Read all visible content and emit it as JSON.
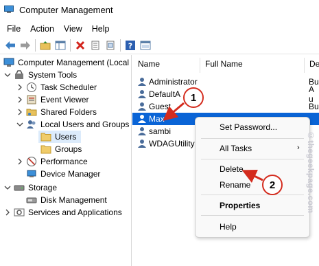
{
  "window": {
    "title": "Computer Management"
  },
  "menubar": {
    "items": [
      "File",
      "Action",
      "View",
      "Help"
    ]
  },
  "toolbar": {
    "buttons": [
      "back-icon",
      "forward-icon",
      "up-folder-icon",
      "show-hide-tree-icon",
      "delete-icon",
      "properties-icon",
      "export-list-icon",
      "help-icon",
      "mmc-pane-icon"
    ]
  },
  "tree": {
    "items": [
      {
        "label": "Computer Management (Local",
        "icon": "computer-icon"
      },
      {
        "label": "System Tools",
        "icon": "tools-icon"
      },
      {
        "label": "Task Scheduler",
        "icon": "clock-icon"
      },
      {
        "label": "Event Viewer",
        "icon": "event-viewer-icon"
      },
      {
        "label": "Shared Folders",
        "icon": "shared-folder-icon"
      },
      {
        "label": "Local Users and Groups",
        "icon": "users-icon"
      },
      {
        "label": "Users",
        "icon": "folder-icon"
      },
      {
        "label": "Groups",
        "icon": "folder-icon"
      },
      {
        "label": "Performance",
        "icon": "performance-icon"
      },
      {
        "label": "Device Manager",
        "icon": "device-manager-icon"
      },
      {
        "label": "Storage",
        "icon": "storage-icon"
      },
      {
        "label": "Disk Management",
        "icon": "disk-icon"
      },
      {
        "label": "Services and Applications",
        "icon": "services-icon"
      }
    ]
  },
  "list": {
    "columns": [
      "Name",
      "Full Name",
      "De"
    ],
    "rows": [
      {
        "name": "Administrator",
        "full_name": "",
        "desc": "Bu"
      },
      {
        "name": "DefaultA",
        "full_name": "",
        "desc": "A u"
      },
      {
        "name": "Guest",
        "full_name": "",
        "desc": "Bu"
      },
      {
        "name": "Max",
        "full_name": "",
        "desc": ""
      },
      {
        "name": "sambi",
        "full_name": "",
        "desc": ""
      },
      {
        "name": "WDAGUtility",
        "full_name": "",
        "desc": ""
      }
    ]
  },
  "context_menu": {
    "items": [
      "Set Password...",
      "All Tasks",
      "Delete",
      "Rename",
      "Properties",
      "Help"
    ],
    "submenu_arrow": "›"
  },
  "annotations": {
    "step1": "1",
    "step2": "2"
  },
  "watermark": "©thegeekpage.com",
  "colors": {
    "selection": "#0a64d6",
    "annotation": "#d42c1e",
    "tree_selection": "#dcebfb"
  }
}
